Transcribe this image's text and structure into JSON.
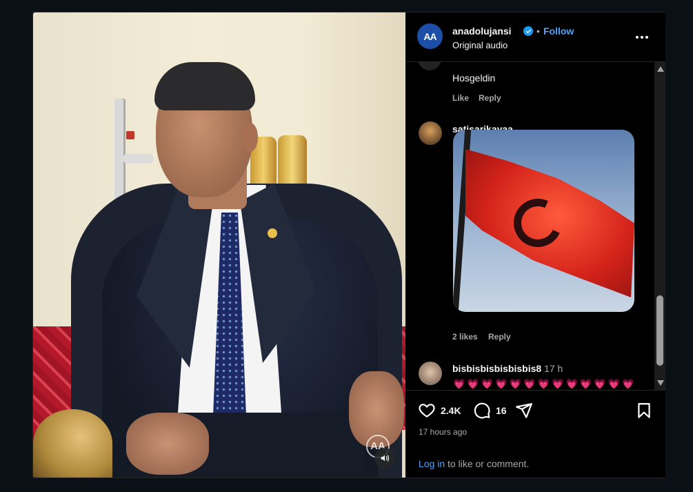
{
  "post": {
    "username": "anadolujansi",
    "avatar_label": "AA",
    "separator": "•",
    "follow_label": "Follow",
    "audio_label": "Original audio",
    "more_icon": "more-horizontal-icon",
    "video_watermark": "AA"
  },
  "comments": [
    {
      "text": "Hosgeldin",
      "like_label": "Like",
      "reply_label": "Reply"
    },
    {
      "username": "satisarikayaa",
      "media": "turkish-flag-gif",
      "likes_label": "2 likes",
      "reply_label": "Reply"
    },
    {
      "username": "bisbisbisbisbisbis8",
      "time": "17 h",
      "hearts": "💗💗💗💗💗💗💗💗💗💗💗💗💗💗💗💗💗💗"
    }
  ],
  "actions": {
    "likes": "2.4K",
    "comments": "16",
    "posted": "17 hours ago"
  },
  "footer": {
    "login_label": "Log in",
    "login_suffix": " to like or comment."
  },
  "colors": {
    "background": "#0b0f16",
    "accent": "#4da3ff",
    "verified": "#1d9bf0",
    "muted": "#a8a8a8"
  }
}
